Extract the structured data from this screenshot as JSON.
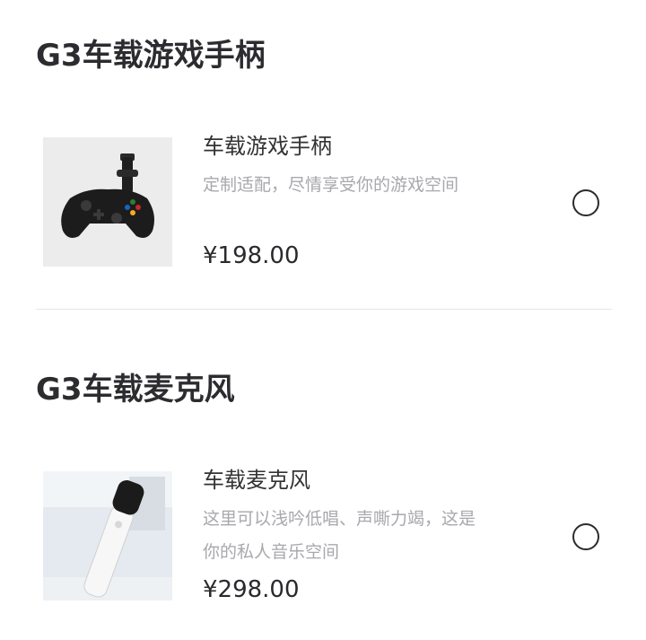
{
  "sections": [
    {
      "title": "G3车载游戏手柄",
      "product": {
        "name": "车载游戏手柄",
        "description": "定制适配，尽情享受你的游戏空间",
        "price": "¥198.00",
        "image_icon": "gamepad-image",
        "selected": false
      }
    },
    {
      "title": "G3车载麦克风",
      "product": {
        "name": "车载麦克风",
        "description": "这里可以浅吟低唱、声嘶力竭，这是你的私人音乐空间",
        "price": "¥298.00",
        "image_icon": "microphone-image",
        "selected": false
      }
    }
  ]
}
